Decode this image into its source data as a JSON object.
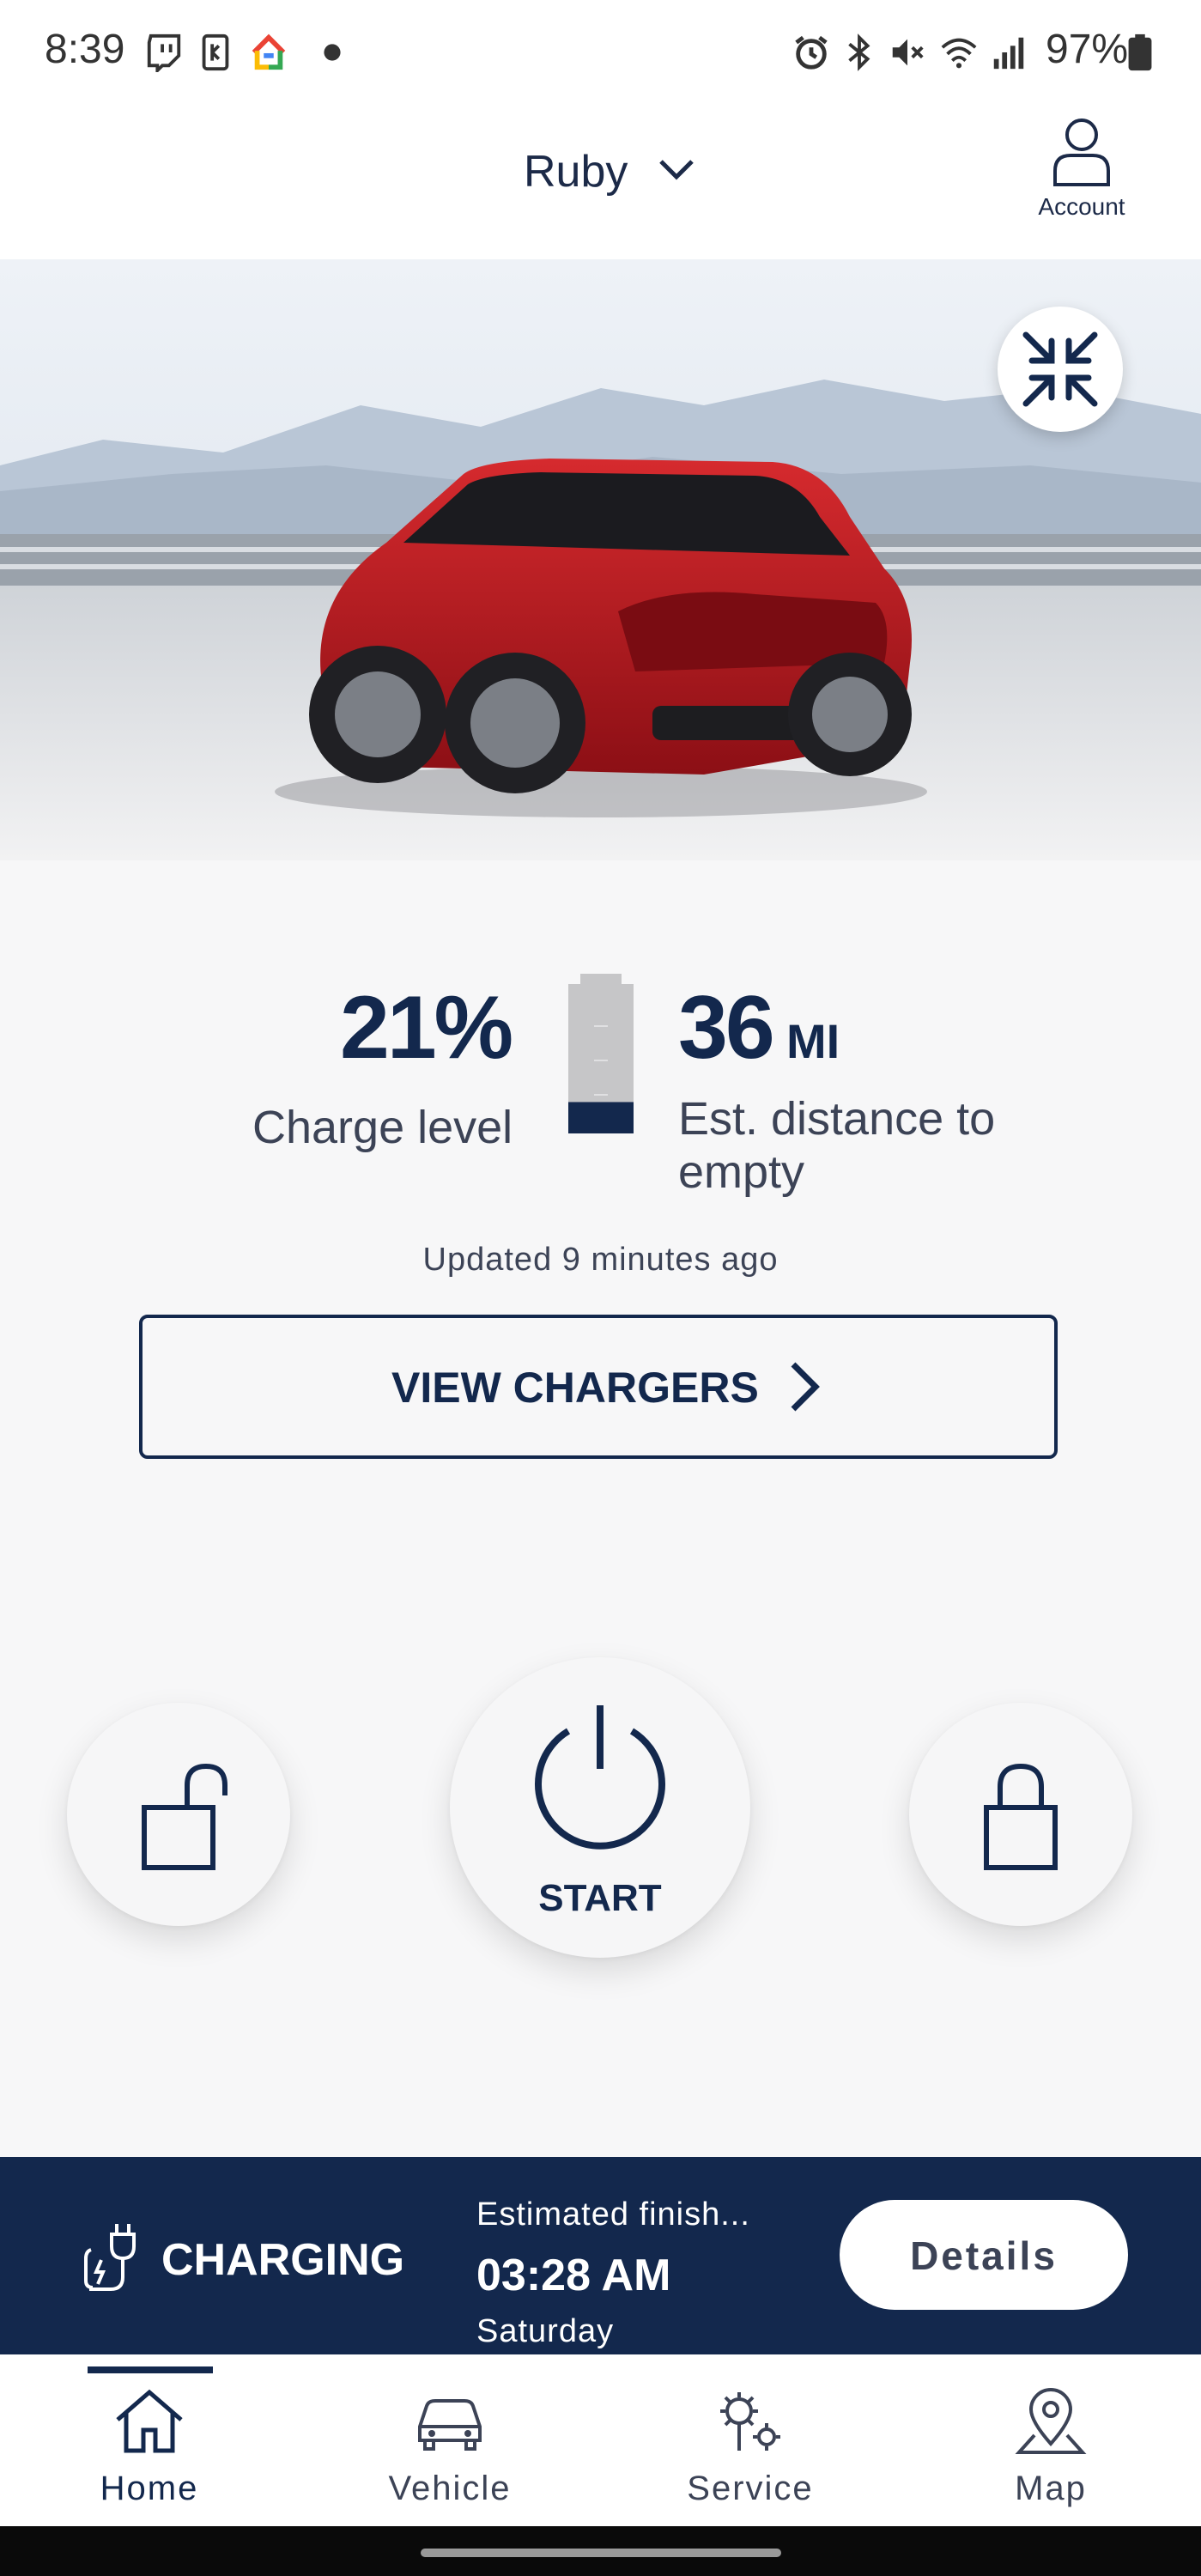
{
  "status_bar": {
    "time": "8:39",
    "battery": "97%",
    "icons": [
      "twitch-icon",
      "notification-icon",
      "google-home-icon",
      "dot-icon",
      "alarm-icon",
      "bluetooth-icon",
      "mute-icon",
      "wifi-icon",
      "signal-icon",
      "battery-icon"
    ]
  },
  "header": {
    "vehicle_name": "Ruby",
    "account_label": "Account"
  },
  "stats": {
    "charge_value": "21%",
    "charge_label": "Charge level",
    "charge_fraction": 0.21,
    "distance_value": "36",
    "distance_unit": "MI",
    "distance_label": "Est. distance to empty",
    "updated": "Updated 9 minutes ago"
  },
  "actions": {
    "view_chargers": "VIEW CHARGERS",
    "start_label": "START",
    "unlock_icon": "unlock-icon",
    "lock_icon": "lock-icon"
  },
  "charging": {
    "title": "CHARGING",
    "finish_label": "Estimated finish...",
    "finish_time": "03:28 AM",
    "finish_day": "Saturday",
    "details_label": "Details"
  },
  "nav": {
    "items": [
      {
        "label": "Home",
        "icon": "home-icon",
        "active": true
      },
      {
        "label": "Vehicle",
        "icon": "car-icon",
        "active": false
      },
      {
        "label": "Service",
        "icon": "service-icon",
        "active": false
      },
      {
        "label": "Map",
        "icon": "map-pin-icon",
        "active": false
      }
    ]
  },
  "colors": {
    "brand_navy": "#13284d",
    "background": "#f7f7f8",
    "vehicle_red": "#b3141d"
  }
}
